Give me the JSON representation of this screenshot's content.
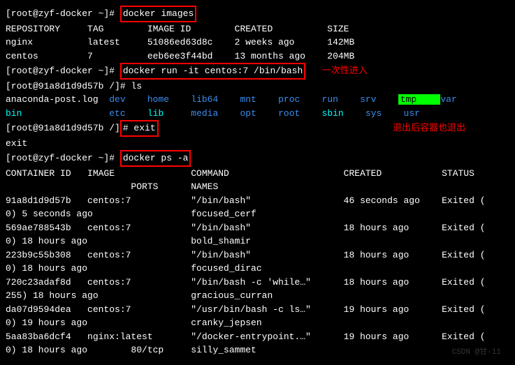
{
  "prompt1": "[root@zyf-docker ~]# ",
  "cmd1": "docker images",
  "images_header": [
    "REPOSITORY",
    "TAG",
    "IMAGE ID",
    "CREATED",
    "SIZE"
  ],
  "images": [
    {
      "repo": "nginx",
      "tag": "latest",
      "id": "51086ed63d8c",
      "created": "2 weeks ago",
      "size": "142MB"
    },
    {
      "repo": "centos",
      "tag": "7",
      "id": "eeb6ee3f44bd",
      "created": "13 months ago",
      "size": "204MB"
    }
  ],
  "cmd2": "docker run -it centos:7 /bin/bash",
  "annot1": "一次性进入",
  "prompt2a": "[root@91a8d1d9d57b /]# ",
  "cmd_ls": "ls",
  "ls_out": [
    [
      {
        "t": "anaconda-post.log",
        "c": ""
      },
      {
        "t": "dev",
        "c": "blue"
      },
      {
        "t": "home",
        "c": "blue"
      },
      {
        "t": "lib64",
        "c": "blue"
      },
      {
        "t": "mnt",
        "c": "blue"
      },
      {
        "t": "proc",
        "c": "blue"
      },
      {
        "t": "run",
        "c": "blue"
      },
      {
        "t": "srv",
        "c": "blue"
      },
      {
        "t": "tmp",
        "c": "green-bg"
      },
      {
        "t": "var",
        "c": "blue"
      }
    ],
    [
      {
        "t": "bin",
        "c": "cyan"
      },
      {
        "t": "etc",
        "c": "blue"
      },
      {
        "t": "lib",
        "c": "cyan"
      },
      {
        "t": "media",
        "c": "blue"
      },
      {
        "t": "opt",
        "c": "blue"
      },
      {
        "t": "root",
        "c": "blue"
      },
      {
        "t": "sbin",
        "c": "cyan"
      },
      {
        "t": "sys",
        "c": "blue"
      },
      {
        "t": "usr",
        "c": "blue"
      }
    ]
  ],
  "exit_prefix": "[root@91a8d1d9d57b /]",
  "exit_cmd": "# exit",
  "annot2": "退出后容器也退出",
  "exit_out": "exit",
  "cmd3": "docker ps -a",
  "ps_header1": [
    "CONTAINER ID",
    "IMAGE",
    "COMMAND",
    "CREATED",
    "STATUS"
  ],
  "ps_header2": [
    "PORTS",
    "NAMES"
  ],
  "ps_rows": [
    {
      "id": "91a8d1d9d57b",
      "img": "centos:7",
      "cmd": "\"/bin/bash\"",
      "created": "46 seconds ago",
      "status": "Exited (",
      "extra": "0) 5 seconds ago",
      "name": "focused_cerf",
      "ports": ""
    },
    {
      "id": "569ae788543b",
      "img": "centos:7",
      "cmd": "\"/bin/bash\"",
      "created": "18 hours ago",
      "status": "Exited (",
      "extra": "0) 18 hours ago",
      "name": "bold_shamir",
      "ports": ""
    },
    {
      "id": "223b9c55b308",
      "img": "centos:7",
      "cmd": "\"/bin/bash\"",
      "created": "18 hours ago",
      "status": "Exited (",
      "extra": "0) 18 hours ago",
      "name": "focused_dirac",
      "ports": ""
    },
    {
      "id": "720c23adaf8d",
      "img": "centos:7",
      "cmd": "\"/bin/bash -c 'while…\"",
      "created": "18 hours ago",
      "status": "Exited (",
      "extra": "255) 18 hours ago",
      "name": "gracious_curran",
      "ports": ""
    },
    {
      "id": "da07d9594dea",
      "img": "centos:7",
      "cmd": "\"/usr/bin/bash -c ls…\"",
      "created": "19 hours ago",
      "status": "Exited (",
      "extra": "0) 19 hours ago",
      "name": "cranky_jepsen",
      "ports": ""
    },
    {
      "id": "5aa83ba6dcf4",
      "img": "nginx:latest",
      "cmd": "\"/docker-entrypoint.…\"",
      "created": "19 hours ago",
      "status": "Exited (",
      "extra": "0) 18 hours ago",
      "name": "silly_sammet",
      "ports": "80/tcp"
    }
  ],
  "watermark": "CSDN @甘-11"
}
